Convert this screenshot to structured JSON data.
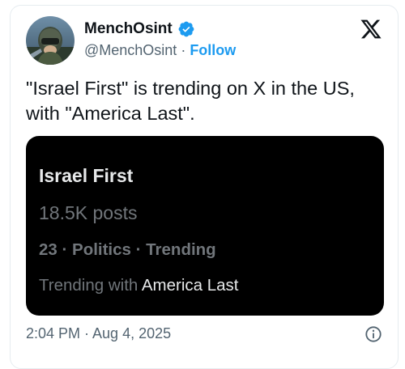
{
  "author": {
    "display_name": "MenchOsint",
    "handle": "@MenchOsint",
    "separator": "·",
    "follow_label": "Follow",
    "verified": true
  },
  "tweet": {
    "text": "\"Israel First\" is trending on X in the US, with \"America Last\".",
    "timestamp": "2:04 PM · Aug 4, 2025"
  },
  "trend": {
    "title": "Israel First",
    "posts": "18.5K posts",
    "meta": "23 · Politics · Trending",
    "with_prefix": "Trending with ",
    "with_term": "America Last"
  },
  "icons": {
    "brand": "x-logo-icon",
    "verified": "verified-badge-icon",
    "info": "info-icon"
  },
  "colors": {
    "accent": "#1d9bf0",
    "text": "#0f1419",
    "secondary_text": "#536471",
    "trend_background": "#000000"
  }
}
